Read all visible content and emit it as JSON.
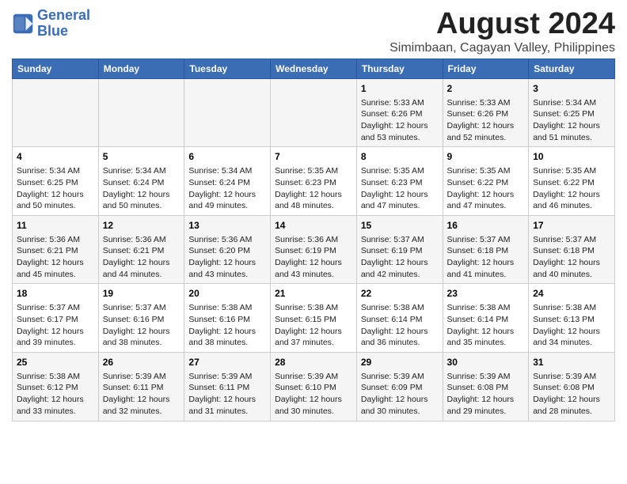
{
  "header": {
    "logo_line1": "General",
    "logo_line2": "Blue",
    "main_title": "August 2024",
    "subtitle": "Simimbaan, Cagayan Valley, Philippines"
  },
  "days_of_week": [
    "Sunday",
    "Monday",
    "Tuesday",
    "Wednesday",
    "Thursday",
    "Friday",
    "Saturday"
  ],
  "weeks": [
    [
      {
        "day": "",
        "content": ""
      },
      {
        "day": "",
        "content": ""
      },
      {
        "day": "",
        "content": ""
      },
      {
        "day": "",
        "content": ""
      },
      {
        "day": "1",
        "content": "Sunrise: 5:33 AM\nSunset: 6:26 PM\nDaylight: 12 hours\nand 53 minutes."
      },
      {
        "day": "2",
        "content": "Sunrise: 5:33 AM\nSunset: 6:26 PM\nDaylight: 12 hours\nand 52 minutes."
      },
      {
        "day": "3",
        "content": "Sunrise: 5:34 AM\nSunset: 6:25 PM\nDaylight: 12 hours\nand 51 minutes."
      }
    ],
    [
      {
        "day": "4",
        "content": "Sunrise: 5:34 AM\nSunset: 6:25 PM\nDaylight: 12 hours\nand 50 minutes."
      },
      {
        "day": "5",
        "content": "Sunrise: 5:34 AM\nSunset: 6:24 PM\nDaylight: 12 hours\nand 50 minutes."
      },
      {
        "day": "6",
        "content": "Sunrise: 5:34 AM\nSunset: 6:24 PM\nDaylight: 12 hours\nand 49 minutes."
      },
      {
        "day": "7",
        "content": "Sunrise: 5:35 AM\nSunset: 6:23 PM\nDaylight: 12 hours\nand 48 minutes."
      },
      {
        "day": "8",
        "content": "Sunrise: 5:35 AM\nSunset: 6:23 PM\nDaylight: 12 hours\nand 47 minutes."
      },
      {
        "day": "9",
        "content": "Sunrise: 5:35 AM\nSunset: 6:22 PM\nDaylight: 12 hours\nand 47 minutes."
      },
      {
        "day": "10",
        "content": "Sunrise: 5:35 AM\nSunset: 6:22 PM\nDaylight: 12 hours\nand 46 minutes."
      }
    ],
    [
      {
        "day": "11",
        "content": "Sunrise: 5:36 AM\nSunset: 6:21 PM\nDaylight: 12 hours\nand 45 minutes."
      },
      {
        "day": "12",
        "content": "Sunrise: 5:36 AM\nSunset: 6:21 PM\nDaylight: 12 hours\nand 44 minutes."
      },
      {
        "day": "13",
        "content": "Sunrise: 5:36 AM\nSunset: 6:20 PM\nDaylight: 12 hours\nand 43 minutes."
      },
      {
        "day": "14",
        "content": "Sunrise: 5:36 AM\nSunset: 6:19 PM\nDaylight: 12 hours\nand 43 minutes."
      },
      {
        "day": "15",
        "content": "Sunrise: 5:37 AM\nSunset: 6:19 PM\nDaylight: 12 hours\nand 42 minutes."
      },
      {
        "day": "16",
        "content": "Sunrise: 5:37 AM\nSunset: 6:18 PM\nDaylight: 12 hours\nand 41 minutes."
      },
      {
        "day": "17",
        "content": "Sunrise: 5:37 AM\nSunset: 6:18 PM\nDaylight: 12 hours\nand 40 minutes."
      }
    ],
    [
      {
        "day": "18",
        "content": "Sunrise: 5:37 AM\nSunset: 6:17 PM\nDaylight: 12 hours\nand 39 minutes."
      },
      {
        "day": "19",
        "content": "Sunrise: 5:37 AM\nSunset: 6:16 PM\nDaylight: 12 hours\nand 38 minutes."
      },
      {
        "day": "20",
        "content": "Sunrise: 5:38 AM\nSunset: 6:16 PM\nDaylight: 12 hours\nand 38 minutes."
      },
      {
        "day": "21",
        "content": "Sunrise: 5:38 AM\nSunset: 6:15 PM\nDaylight: 12 hours\nand 37 minutes."
      },
      {
        "day": "22",
        "content": "Sunrise: 5:38 AM\nSunset: 6:14 PM\nDaylight: 12 hours\nand 36 minutes."
      },
      {
        "day": "23",
        "content": "Sunrise: 5:38 AM\nSunset: 6:14 PM\nDaylight: 12 hours\nand 35 minutes."
      },
      {
        "day": "24",
        "content": "Sunrise: 5:38 AM\nSunset: 6:13 PM\nDaylight: 12 hours\nand 34 minutes."
      }
    ],
    [
      {
        "day": "25",
        "content": "Sunrise: 5:38 AM\nSunset: 6:12 PM\nDaylight: 12 hours\nand 33 minutes."
      },
      {
        "day": "26",
        "content": "Sunrise: 5:39 AM\nSunset: 6:11 PM\nDaylight: 12 hours\nand 32 minutes."
      },
      {
        "day": "27",
        "content": "Sunrise: 5:39 AM\nSunset: 6:11 PM\nDaylight: 12 hours\nand 31 minutes."
      },
      {
        "day": "28",
        "content": "Sunrise: 5:39 AM\nSunset: 6:10 PM\nDaylight: 12 hours\nand 30 minutes."
      },
      {
        "day": "29",
        "content": "Sunrise: 5:39 AM\nSunset: 6:09 PM\nDaylight: 12 hours\nand 30 minutes."
      },
      {
        "day": "30",
        "content": "Sunrise: 5:39 AM\nSunset: 6:08 PM\nDaylight: 12 hours\nand 29 minutes."
      },
      {
        "day": "31",
        "content": "Sunrise: 5:39 AM\nSunset: 6:08 PM\nDaylight: 12 hours\nand 28 minutes."
      }
    ]
  ]
}
